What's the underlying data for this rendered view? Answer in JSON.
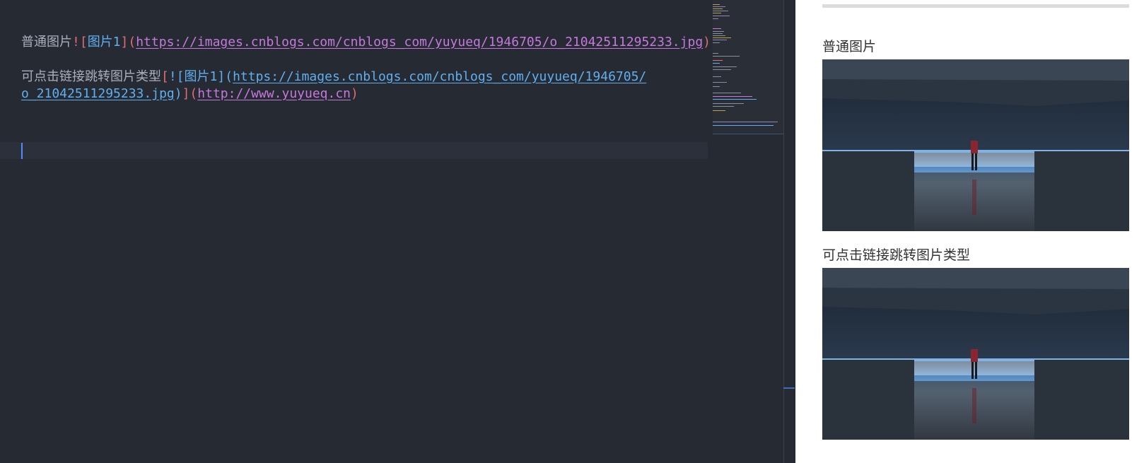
{
  "editor": {
    "line1": {
      "text": "普通图片",
      "bang": "!",
      "open_bracket": "[",
      "alt": "图片1",
      "close_open_paren": "](",
      "url": "https://images.cnblogs.com/cnblogs_com/yuyueq/1946705/o_21042511295233.jpg",
      "close_paren": ")"
    },
    "line2": {
      "text": "可点击链接跳转图片类型",
      "open_bracket": "[",
      "bang": "!",
      "inner_open": "[",
      "alt": "图片1",
      "close_open_paren": "](",
      "url_part1": "https://images.cnblogs.com/cnblogs_com/yuyueq/1946705/",
      "url_part2": "o_21042511295233.jpg",
      "close_paren": ")",
      "close_open_paren2": "](",
      "link_url": "http://www.yuyueq.cn",
      "final_paren": ")"
    }
  },
  "preview": {
    "label1": "普通图片",
    "label2": "可点击链接跳转图片类型",
    "image1_icon": "space-scene-image",
    "image2_icon": "space-scene-image"
  },
  "colors": {
    "editor_bg": "#262a33",
    "text": "#a9afbb",
    "punct": "#e06c75",
    "link_blue": "#61afef",
    "link_purple": "#c678dd",
    "cursor": "#528bff"
  }
}
